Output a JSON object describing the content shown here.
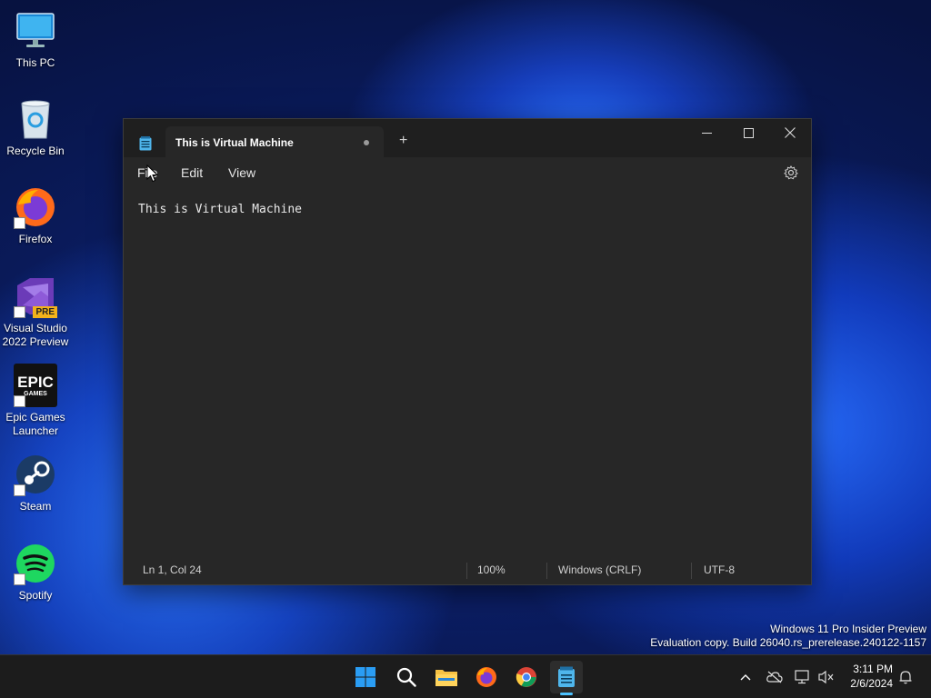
{
  "desktop": {
    "icons": [
      {
        "label": "This PC",
        "icon": "monitor-icon"
      },
      {
        "label": "Recycle Bin",
        "icon": "recycle-bin-icon"
      },
      {
        "label": "Firefox",
        "icon": "firefox-icon"
      },
      {
        "label": "Visual Studio 2022 Preview",
        "icon": "visual-studio-icon",
        "badge": "PRE"
      },
      {
        "label": "Epic Games Launcher",
        "icon": "epic-games-icon",
        "logo_text": "EPIC",
        "logo_sub": "GAMES"
      },
      {
        "label": "Steam",
        "icon": "steam-icon"
      },
      {
        "label": "Spotify",
        "icon": "spotify-icon"
      }
    ]
  },
  "notepad": {
    "tab_title": "This is Virtual Machine",
    "new_tab": "+",
    "menu": {
      "file": "File",
      "edit": "Edit",
      "view": "View"
    },
    "content": "This is Virtual Machine",
    "status": {
      "position": "Ln 1, Col 24",
      "zoom": "100%",
      "line_ending": "Windows (CRLF)",
      "encoding": "UTF-8"
    }
  },
  "watermark": {
    "line1": "Windows 11 Pro Insider Preview",
    "line2": "Evaluation copy. Build 26040.rs_prerelease.240122-1157"
  },
  "taskbar": {
    "apps": [
      "start-icon",
      "search-icon",
      "file-explorer-icon",
      "firefox-icon",
      "chrome-icon",
      "notepad-icon"
    ],
    "active_app": "notepad-icon",
    "clock": {
      "time": "3:11 PM",
      "date": "2/6/2024"
    }
  },
  "colors": {
    "accent": "#4cc2ff",
    "window_bg": "#272727",
    "titlebar_bg": "#1f1f1f",
    "taskbar_bg": "#1c1c1c"
  }
}
